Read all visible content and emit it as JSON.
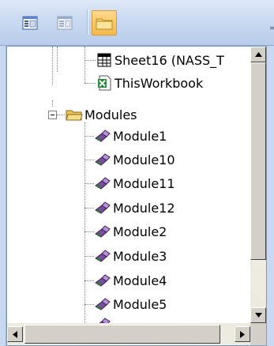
{
  "toolbar": {
    "buttons": [
      {
        "name": "view-code",
        "icon": "code-window-icon"
      },
      {
        "name": "view-object",
        "icon": "form-window-icon"
      },
      {
        "name": "toggle-folders",
        "icon": "folder-icon",
        "pressed": true
      }
    ],
    "overflow_glyph": "="
  },
  "tree": {
    "items": [
      {
        "label": "Sheet16 (NASS_T",
        "icon": "worksheet-icon"
      },
      {
        "label": "ThisWorkbook",
        "icon": "workbook-icon"
      },
      {
        "label": "Modules",
        "icon": "folder-open-icon",
        "expanded": true
      },
      {
        "label": "Module1",
        "icon": "module-icon"
      },
      {
        "label": "Module10",
        "icon": "module-icon"
      },
      {
        "label": "Module11",
        "icon": "module-icon"
      },
      {
        "label": "Module12",
        "icon": "module-icon"
      },
      {
        "label": "Module2",
        "icon": "module-icon"
      },
      {
        "label": "Module3",
        "icon": "module-icon"
      },
      {
        "label": "Module4",
        "icon": "module-icon"
      },
      {
        "label": "Module5",
        "icon": "module-icon"
      }
    ]
  },
  "colors": {
    "toolbar_top": "#dfe9f8",
    "toolbar_bottom": "#b8cdea",
    "pressed_button": "#f3b94d",
    "panel_bg": "#ffffff",
    "tree_line": "#808080"
  }
}
